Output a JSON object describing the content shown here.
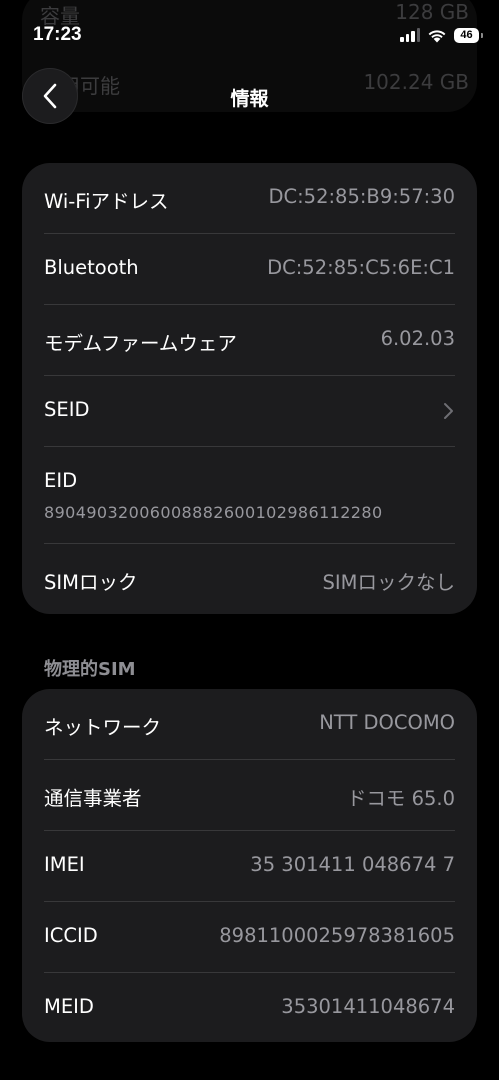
{
  "status_bar": {
    "time": "17:23",
    "battery": "46"
  },
  "underlay": {
    "row1_label": "容量",
    "row1_value": "128 GB",
    "row2_label": "使用可能",
    "row2_value": "102.24 GB"
  },
  "nav": {
    "title": "情報",
    "back_icon": "chevron-left-icon"
  },
  "info_card": {
    "rows": [
      {
        "label": "Wi-Fiアドレス",
        "value": "DC:52:85:B9:57:30"
      },
      {
        "label": "Bluetooth",
        "value": "DC:52:85:C5:6E:C1"
      },
      {
        "label": "モデムファームウェア",
        "value": "6.02.03"
      },
      {
        "label": "SEID",
        "value": ""
      },
      {
        "label": "EID",
        "value": "89049032006008882600102986112280"
      },
      {
        "label": "SIMロック",
        "value": "SIMロックなし"
      }
    ]
  },
  "physical_sim": {
    "header": "物理的SIM",
    "rows": [
      {
        "label": "ネットワーク",
        "value": "NTT DOCOMO"
      },
      {
        "label": "通信事業者",
        "value": "ドコモ 65.0"
      },
      {
        "label": "IMEI",
        "value": "35 301411 048674 7"
      },
      {
        "label": "ICCID",
        "value": "8981100025978381605"
      },
      {
        "label": "MEID",
        "value": "35301411048674"
      }
    ]
  },
  "colors": {
    "background": "#000000",
    "card": "#1c1c1e",
    "separator": "#38383a",
    "secondary_text": "#98989e"
  }
}
